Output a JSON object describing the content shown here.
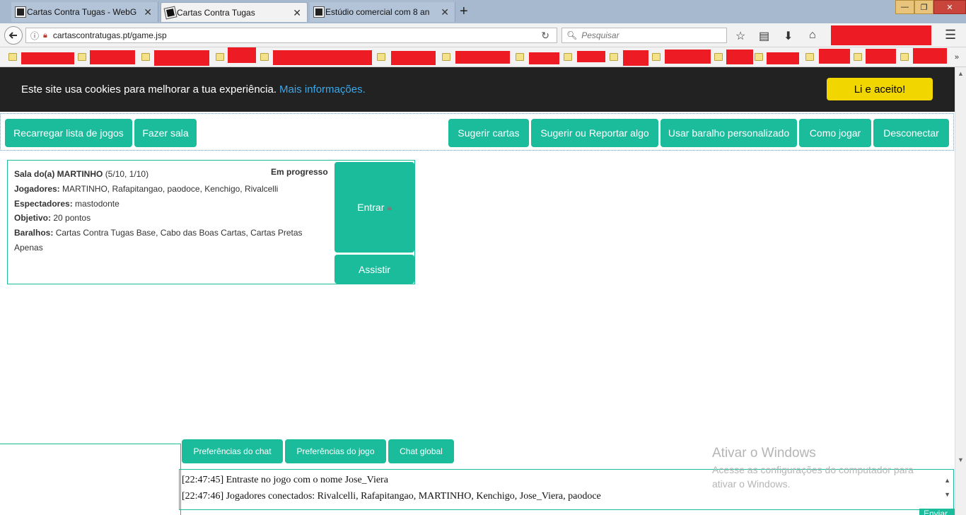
{
  "browser": {
    "tabs": [
      {
        "title": "Cartas Contra Tugas - WebG"
      },
      {
        "title": "Cartas Contra Tugas"
      },
      {
        "title": "Estúdio comercial com 8 an"
      }
    ],
    "new_tab": "+",
    "close_glyph": "✕",
    "url": "cartascontratugas.pt/game.jsp",
    "search_placeholder": "Pesquisar",
    "window_controls": {
      "minimize": "—",
      "restore": "❐",
      "close": "✕"
    },
    "icons": {
      "back": "back-arrow-icon",
      "info": "info-icon",
      "reload": "reload-icon",
      "search": "search-icon",
      "star": "star-icon",
      "reader": "reading-list-icon",
      "download": "download-icon",
      "home": "home-icon",
      "menu": "hamburger-menu-icon"
    },
    "bookmarks_overflow": "»"
  },
  "cookie": {
    "message": "Este site usa cookies para melhorar a tua experiência.",
    "link": "Mais informações.",
    "accept": "Li e aceito!",
    "colors": {
      "bar": "#222222",
      "link": "#3ea7e8",
      "button": "#f1d600"
    }
  },
  "toolbar": {
    "reload": "Recarregar lista de jogos",
    "create_room": "Fazer sala",
    "suggest_cards": "Sugerir cartas",
    "suggest_report": "Sugerir ou Reportar algo",
    "custom_deck": "Usar baralho personalizado",
    "how_to_play": "Como jogar",
    "disconnect": "Desconectar"
  },
  "accent_color": "#1abc9c",
  "room": {
    "title": "Sala do(a) MARTINHO",
    "counts": "(5/10, 1/10)",
    "status": "Em progresso",
    "players_label": "Jogadores:",
    "players": "MARTINHO, Rafapitangao, paodoce, Kenchigo, Rivalcelli",
    "spectators_label": "Espectadores:",
    "spectators": "mastodonte",
    "goal_label": "Objetivo:",
    "goal": "20 pontos",
    "decks_label": "Baralhos:",
    "decks": "Cartas Contra Tugas Base, Cabo das Boas Cartas, Cartas Pretas Apenas",
    "join": "Entrar",
    "watch": "Assistir"
  },
  "chat": {
    "tabs": {
      "chat_prefs": "Preferências do chat",
      "game_prefs": "Preferências do jogo",
      "global_chat": "Chat global"
    },
    "messages": [
      "[22:47:45] Entraste no jogo com o nome Jose_Viera",
      "[22:47:46] Jogadores conectados: Rivalcelli, Rafapitangao, MARTINHO, Kenchigo, Jose_Viera, paodoce"
    ],
    "send": "Enviar"
  },
  "watermark": {
    "title": "Ativar o Windows",
    "subtitle": "Acesse as configurações do computador para ativar o Windows."
  }
}
